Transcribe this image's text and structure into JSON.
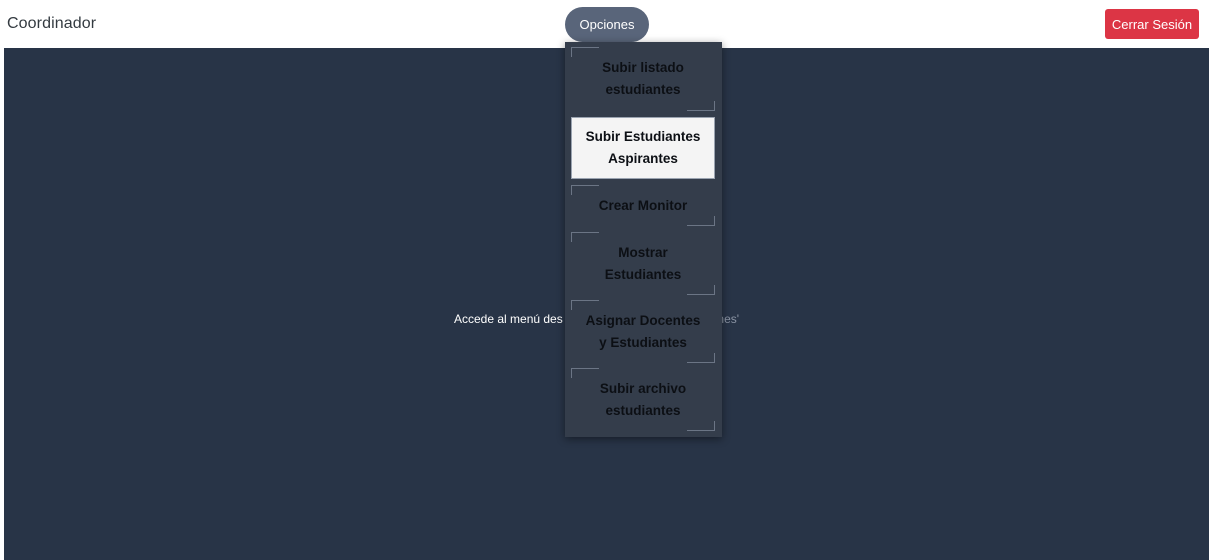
{
  "navbar": {
    "brand": "Coordinador",
    "options_label": "Opciones",
    "logout_label": "Cerrar Sesión"
  },
  "main": {
    "hint_visible_start": "Accede al menú des",
    "hint_visible_end": "ones'"
  },
  "dropdown": {
    "items": [
      {
        "label": "Subir listado estudiantes"
      },
      {
        "label": "Subir Estudiantes Aspirantes",
        "active": true
      },
      {
        "label": "Crear Monitor"
      },
      {
        "label": "Mostrar Estudiantes"
      },
      {
        "label": "Asignar Docentes y Estudiantes"
      },
      {
        "label": "Subir archivo estudiantes"
      }
    ]
  },
  "colors": {
    "main_bg": "#283447",
    "dropdown_bg": "#343d4b",
    "options_btn": "#59657a",
    "logout_btn": "#dc3545"
  }
}
